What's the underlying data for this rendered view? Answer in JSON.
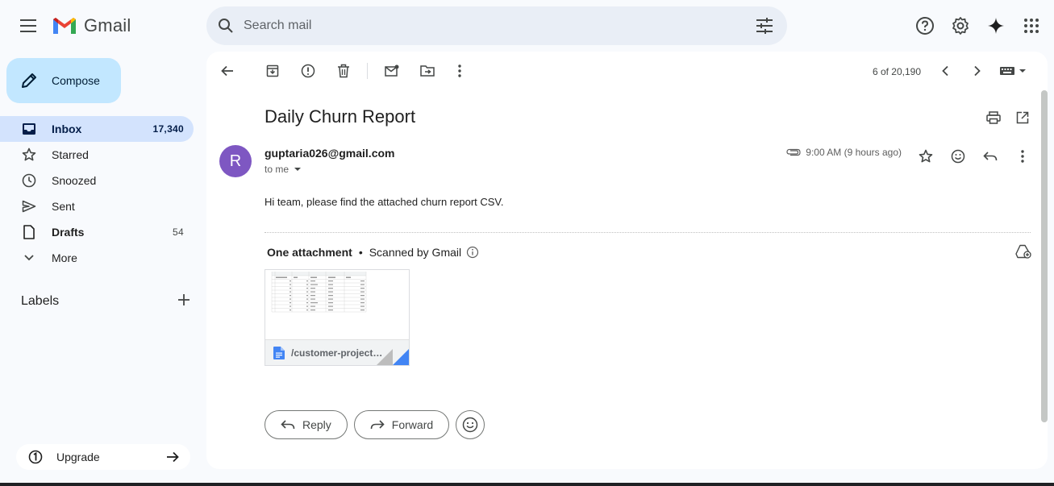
{
  "app": {
    "name": "Gmail"
  },
  "search": {
    "placeholder": "Search mail"
  },
  "sidebar": {
    "compose_label": "Compose",
    "items": [
      {
        "label": "Inbox",
        "count": "17,340",
        "icon": "inbox-icon",
        "active": true
      },
      {
        "label": "Starred",
        "count": "",
        "icon": "star-icon"
      },
      {
        "label": "Snoozed",
        "count": "",
        "icon": "clock-icon"
      },
      {
        "label": "Sent",
        "count": "",
        "icon": "send-icon"
      },
      {
        "label": "Drafts",
        "count": "54",
        "icon": "draft-icon"
      },
      {
        "label": "More",
        "count": "",
        "icon": "chevron-down-icon"
      }
    ],
    "labels_title": "Labels",
    "upgrade_label": "Upgrade"
  },
  "toolbar": {
    "pager": "6 of 20,190"
  },
  "email": {
    "subject": "Daily Churn Report",
    "avatar_letter": "R",
    "sender": "guptaria026@gmail.com",
    "to": "to me",
    "time": "9:00 AM (9 hours ago)",
    "body": "Hi team, please find the attached churn report CSV.",
    "attachment_count_label": "One attachment",
    "scan_label": "Scanned by Gmail",
    "attachment_name": "/customer-project-churn.csv"
  },
  "actions": {
    "reply": "Reply",
    "forward": "Forward"
  },
  "colors": {
    "accent": "#0b57d0",
    "compose_bg": "#c2e7ff",
    "active_nav": "#d3e3fd",
    "avatar": "#7e57c2"
  }
}
